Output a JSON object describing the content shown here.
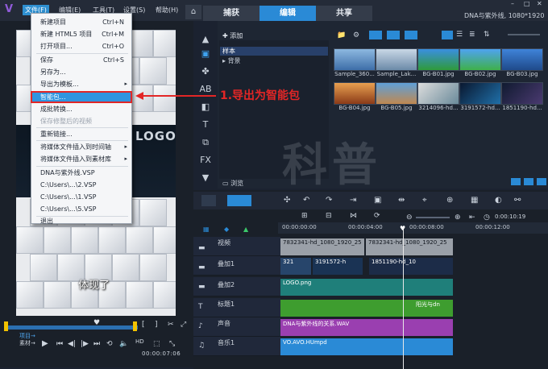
{
  "titlebar": {
    "menus": [
      "文件(F)",
      "编辑(E)",
      "工具(T)",
      "设置(S)",
      "帮助(H)"
    ],
    "tabs": [
      "捕获",
      "编辑",
      "共享"
    ],
    "project": "DNA与紫外线, 1080*1920"
  },
  "file_menu": {
    "items": [
      {
        "label": "新建项目",
        "shortcut": "Ctrl+N"
      },
      {
        "label": "新建 HTML5 项目",
        "shortcut": "Ctrl+M"
      },
      {
        "label": "打开项目...",
        "shortcut": "Ctrl+O"
      },
      {
        "label": "保存",
        "shortcut": "Ctrl+S"
      },
      {
        "label": "另存为...",
        "shortcut": ""
      },
      {
        "label": "导出为模板...",
        "shortcut": ""
      },
      {
        "label": "智能包...",
        "shortcut": ""
      },
      {
        "label": "成批转换...",
        "shortcut": ""
      },
      {
        "label": "保存修整后的视频",
        "shortcut": ""
      },
      {
        "label": "重新链接...",
        "shortcut": ""
      },
      {
        "label": "将媒体文件插入到时间轴",
        "shortcut": ""
      },
      {
        "label": "将媒体文件插入到素材库",
        "shortcut": ""
      },
      {
        "label": "DNA与紫外线.VSP",
        "shortcut": ""
      },
      {
        "label": "C:\\Users\\...\\2.VSP",
        "shortcut": ""
      },
      {
        "label": "C:\\Users\\...\\1.VSP",
        "shortcut": ""
      },
      {
        "label": "C:\\Users\\...\\5.VSP",
        "shortcut": ""
      },
      {
        "label": "退出",
        "shortcut": ""
      }
    ]
  },
  "annotation": "1.导出为智能包",
  "player": {
    "logo_text": "LOGO",
    "caption": "体现了",
    "mode_project": "项目→",
    "mode_clip": "素材→",
    "timecode": "00:00:07:06"
  },
  "library": {
    "add_label": "添加",
    "folders": [
      "样本",
      "背景"
    ],
    "browse": "浏览",
    "thumbs": [
      "Sample_360...",
      "Sample_Lak...",
      "BG-B01.jpg",
      "BG-B02.jpg",
      "BG-B03.jpg",
      "BG-B04.jpg",
      "BG-B05.jpg",
      "3214096-hd...",
      "3191572-hd...",
      "1851190-hd..."
    ]
  },
  "timeline": {
    "timecode": "0:00:10:19",
    "ruler": [
      "00:00:00:00",
      "00:00:04:00",
      "00:00:08:00",
      "00:00:12:00"
    ],
    "tracks": [
      "视频",
      "叠加1",
      "叠加2",
      "标题1",
      "声音",
      "音乐1"
    ],
    "clips": {
      "video": "7832341-hd_1080_1920_25",
      "video2": "7832341-hd_1080_1920_25",
      "ov1a": "321",
      "ov1b": "3191572-h",
      "ov1c": "1851190-hd_10",
      "ov2": "LOGO.png",
      "title": "阳光与dn",
      "voice": "DNA与紫外线的关系.WAV",
      "music": "VO.AVO.HUmpd"
    }
  },
  "watermark": "科普"
}
